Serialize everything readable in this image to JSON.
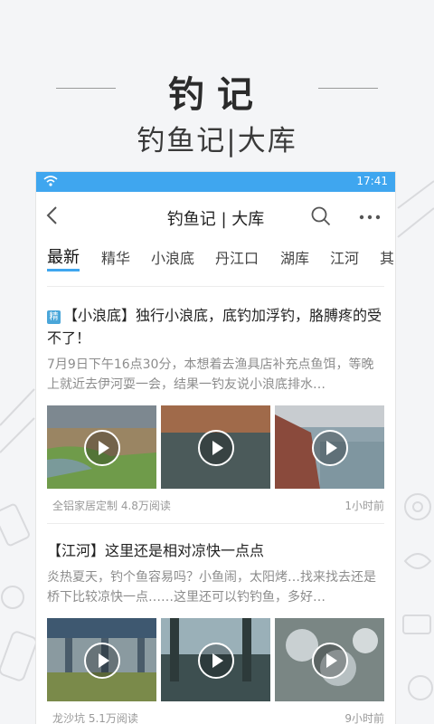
{
  "hero": {
    "title": "钓记",
    "subtitle": "钓鱼记|大库"
  },
  "status_bar": {
    "time": "17:41"
  },
  "appbar": {
    "title": "钓鱼记 | 大库"
  },
  "tabs": [
    {
      "label": "最新",
      "active": true
    },
    {
      "label": "精华"
    },
    {
      "label": "小浪底"
    },
    {
      "label": "丹江口"
    },
    {
      "label": "湖库"
    },
    {
      "label": "江河"
    },
    {
      "label": "其"
    }
  ],
  "articles": [
    {
      "badge": "精",
      "title": "【小浪底】独行小浪底，底钓加浮钓，胳膊疼的受不了！",
      "desc": "7月9日下午16点30分，本想着去渔具店补充点鱼饵，等晚上就近去伊河耍一会，结果一钓友说小浪底排水…",
      "thumbs": [
        "video-thumb-1",
        "video-thumb-2",
        "video-thumb-3"
      ],
      "source": "全铝家居定制",
      "reads": "4.8万阅读",
      "time": "1小时前"
    },
    {
      "badge": "",
      "title": "【江河】这里还是相对凉快一点点",
      "desc": "炎热夏天，钓个鱼容易吗？小鱼闹，太阳烤…找来找去还是桥下比较凉快一点……这里还可以钓钓鱼，多好…",
      "thumbs": [
        "video-thumb-1",
        "video-thumb-2",
        "video-thumb-3"
      ],
      "source": "龙沙坑",
      "reads": "5.1万阅读",
      "time": "9小时前"
    }
  ],
  "colors": {
    "accent": "#3fa6ef",
    "badge": "#4aa6d9"
  }
}
